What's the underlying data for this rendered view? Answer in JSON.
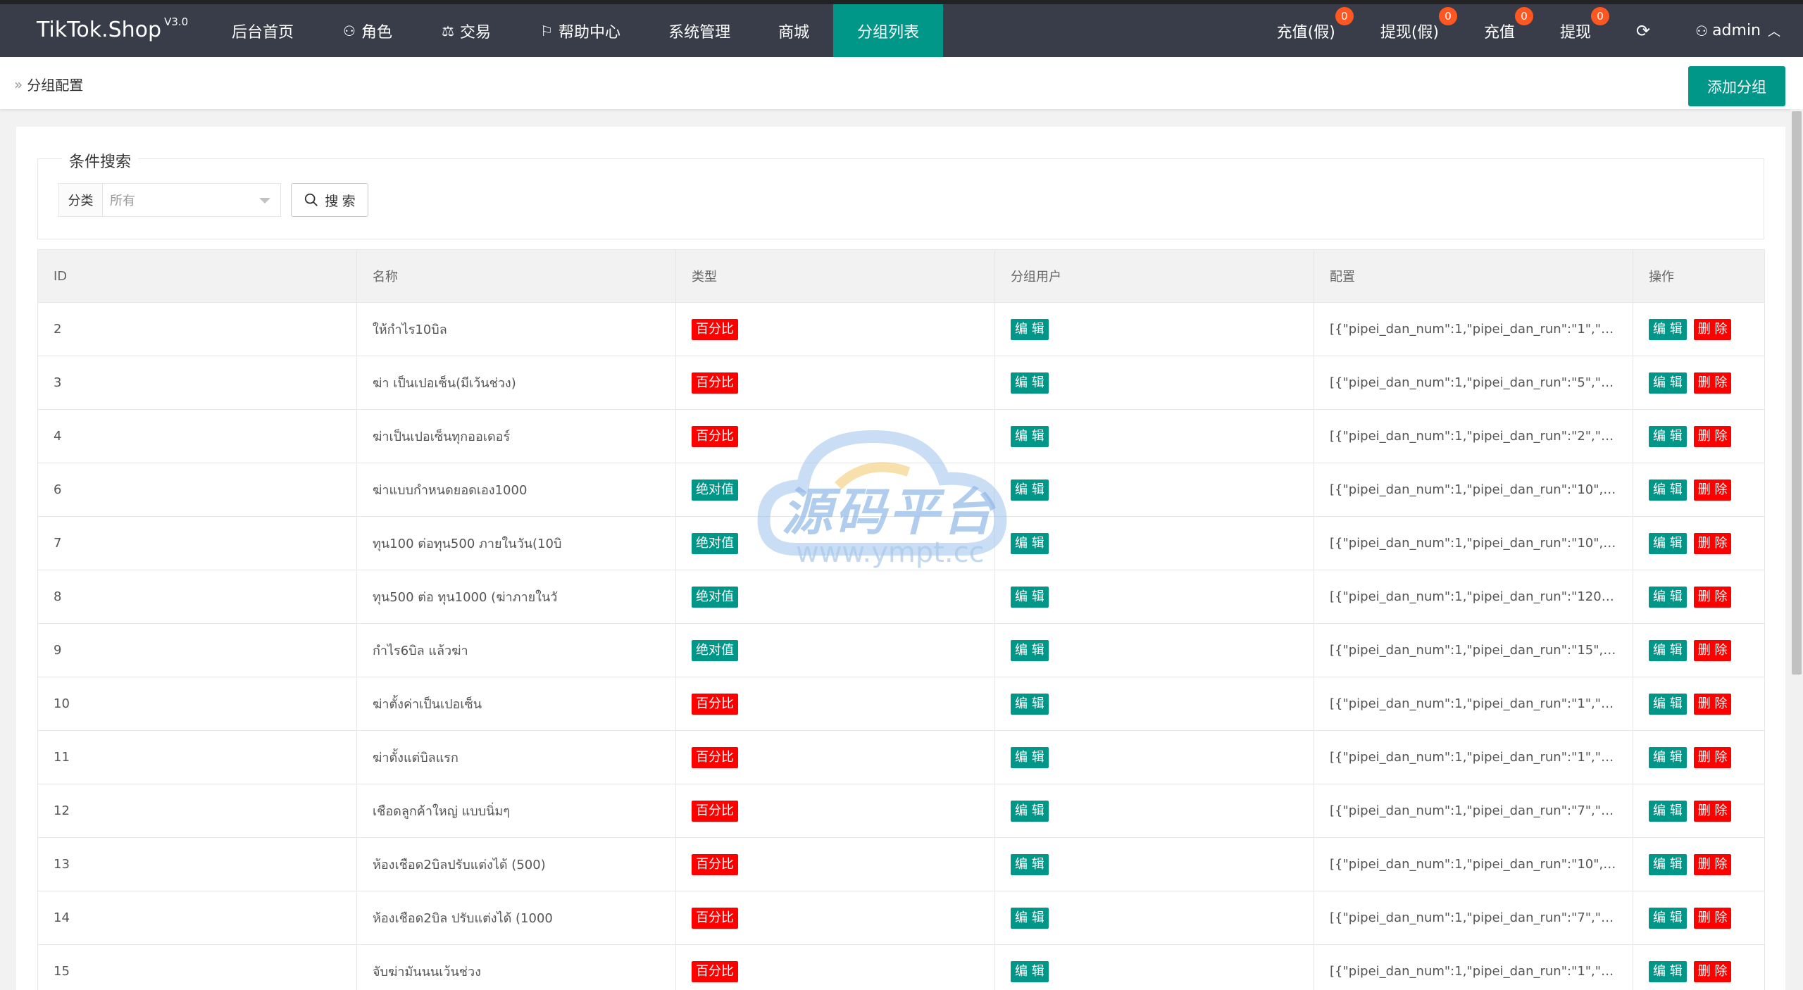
{
  "app": {
    "title": "TikTok.Shop",
    "version": "V3.0"
  },
  "nav": {
    "items": [
      {
        "label": "后台首页",
        "icon": ""
      },
      {
        "label": "角色",
        "icon": "user-icon"
      },
      {
        "label": "交易",
        "icon": "scale-icon"
      },
      {
        "label": "帮助中心",
        "icon": "flag-icon"
      },
      {
        "label": "系统管理",
        "icon": ""
      },
      {
        "label": "商城",
        "icon": ""
      },
      {
        "label": "分组列表",
        "icon": "",
        "active": true
      }
    ]
  },
  "right_nav": {
    "items": [
      {
        "label": "充值(假)",
        "badge": "0"
      },
      {
        "label": "提现(假)",
        "badge": "0"
      },
      {
        "label": "充值",
        "badge": "0"
      },
      {
        "label": "提现",
        "badge": "0"
      }
    ],
    "refresh_icon": "refresh-icon",
    "user": "admin"
  },
  "breadcrumb": {
    "current": "分组配置"
  },
  "add_button": "添加分组",
  "search": {
    "legend": "条件搜索",
    "field_label": "分类",
    "select_value": "所有",
    "button_label": "搜 索"
  },
  "table": {
    "headers": [
      "ID",
      "名称",
      "类型",
      "分组用户",
      "配置",
      "操作"
    ],
    "edit_label": "编 辑",
    "delete_label": "删 除",
    "rows": [
      {
        "id": "2",
        "name": "ให้กำไร10บิล",
        "type": "百分比",
        "type_color": "red",
        "config": "[{\"pipei_dan_num\":1,\"pipei_dan_run\":\"1\",\"pip..."
      },
      {
        "id": "3",
        "name": "ฆ่า เป็นเปอเซ็น(มีเว้นช่วง)",
        "type": "百分比",
        "type_color": "red",
        "config": "[{\"pipei_dan_num\":1,\"pipei_dan_run\":\"5\",\"pip..."
      },
      {
        "id": "4",
        "name": "ฆ่าเป็นเปอเซ็นทุกออเดอร์",
        "type": "百分比",
        "type_color": "red",
        "config": "[{\"pipei_dan_num\":1,\"pipei_dan_run\":\"2\",\"pip..."
      },
      {
        "id": "6",
        "name": "ฆ่าแบบกำหนดยอดเอง1000",
        "type": "绝对值",
        "type_color": "green",
        "config": "[{\"pipei_dan_num\":1,\"pipei_dan_run\":\"10\",\"pi..."
      },
      {
        "id": "7",
        "name": "ทุน100 ต่อทุน500 ภายในวัน(10บิ",
        "type": "绝对值",
        "type_color": "green",
        "config": "[{\"pipei_dan_num\":1,\"pipei_dan_run\":\"10\",\"pi..."
      },
      {
        "id": "8",
        "name": "ทุน500 ต่อ ทุน1000 (ฆ่าภายในวั",
        "type": "绝对值",
        "type_color": "green",
        "config": "[{\"pipei_dan_num\":1,\"pipei_dan_run\":\"120\",\"p..."
      },
      {
        "id": "9",
        "name": "กำไร6บิล แล้วฆ่า",
        "type": "绝对值",
        "type_color": "green",
        "config": "[{\"pipei_dan_num\":1,\"pipei_dan_run\":\"15\",\"pi..."
      },
      {
        "id": "10",
        "name": "ฆ่าตั้งค่าเป็นเปอเซ็น",
        "type": "百分比",
        "type_color": "red",
        "config": "[{\"pipei_dan_num\":1,\"pipei_dan_run\":\"1\",\"pip..."
      },
      {
        "id": "11",
        "name": "ฆ่าตั้งแต่บิลแรก",
        "type": "百分比",
        "type_color": "red",
        "config": "[{\"pipei_dan_num\":1,\"pipei_dan_run\":\"1\",\"pip..."
      },
      {
        "id": "12",
        "name": "เชือดลูกค้าใหญ่ แบบนิ่มๆ",
        "type": "百分比",
        "type_color": "red",
        "config": "[{\"pipei_dan_num\":1,\"pipei_dan_run\":\"7\",\"pip..."
      },
      {
        "id": "13",
        "name": "ห้องเชือด2บิลปรับแต่งได้ (500)",
        "type": "百分比",
        "type_color": "red",
        "config": "[{\"pipei_dan_num\":1,\"pipei_dan_run\":\"10\",\"pi..."
      },
      {
        "id": "14",
        "name": "ห้องเชือด2บิล ปรับแต่งได้ (1000",
        "type": "百分比",
        "type_color": "red",
        "config": "[{\"pipei_dan_num\":1,\"pipei_dan_run\":\"7\",\"pip..."
      },
      {
        "id": "15",
        "name": "จับฆ่ามันนนเว้นช่วง",
        "type": "百分比",
        "type_color": "red",
        "config": "[{\"pipei_dan_num\":1,\"pipei_dan_run\":\"1\",\"pip..."
      }
    ]
  },
  "watermark": {
    "text": "源码平台",
    "url": "www.ympt.cc"
  },
  "colors": {
    "nav_bg": "#393d49",
    "accent": "#009688",
    "danger": "#ff0000",
    "badge": "#ff5722"
  }
}
